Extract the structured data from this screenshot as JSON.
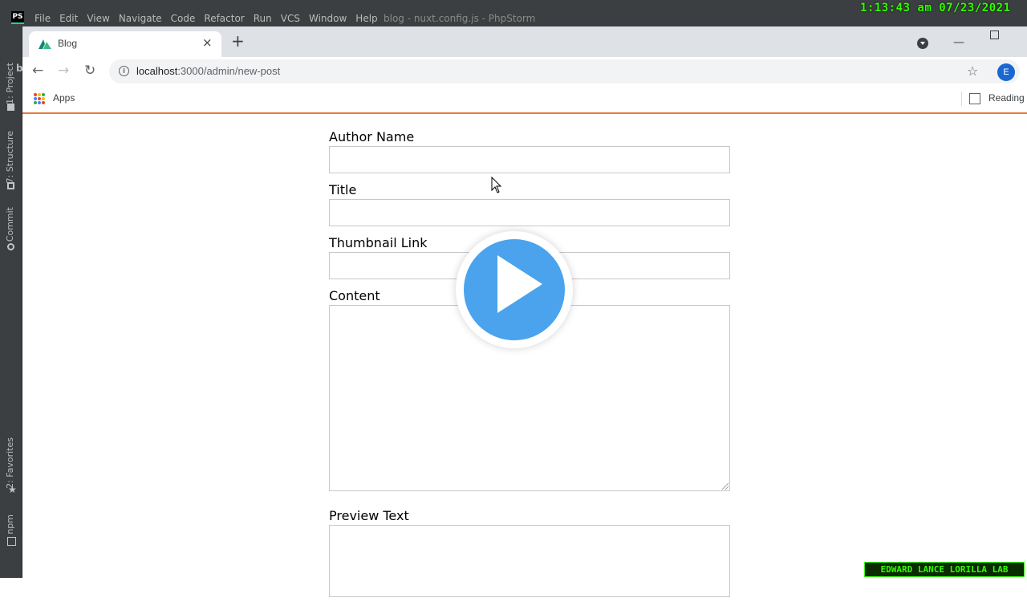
{
  "ide": {
    "logo_text": "PS",
    "menu": [
      "File",
      "Edit",
      "View",
      "Navigate",
      "Code",
      "Refactor",
      "Run",
      "VCS",
      "Window",
      "Help"
    ],
    "title": "blog - nuxt.config.js - PhpStorm",
    "edge_letter": "b",
    "left_tabs": {
      "project": "1: Project",
      "structure": "7: Structure",
      "commit": "Commit",
      "favorites": "2: Favorites",
      "npm": "npm"
    }
  },
  "overlay_clock": "1:13:43 am 07/23/2021",
  "browser": {
    "tab_title": "Blog",
    "tab_close": "×",
    "new_tab": "+",
    "url_host": "localhost",
    "url_path": ":3000/admin/new-post",
    "avatar_letter": "E",
    "bookmarks": {
      "apps": "Apps",
      "reading": "Reading"
    }
  },
  "form": {
    "author_label": "Author Name",
    "title_label": "Title",
    "thumbnail_label": "Thumbnail Link",
    "content_label": "Content",
    "preview_label": "Preview Text"
  },
  "watermark": "EDWARD LANCE LORILLA LAB",
  "colors": {
    "accent_bar": "#ea7a42",
    "play_button": "#4aa3ec",
    "ide_bg": "#3c3f41",
    "overlay_green": "#33ff00"
  }
}
